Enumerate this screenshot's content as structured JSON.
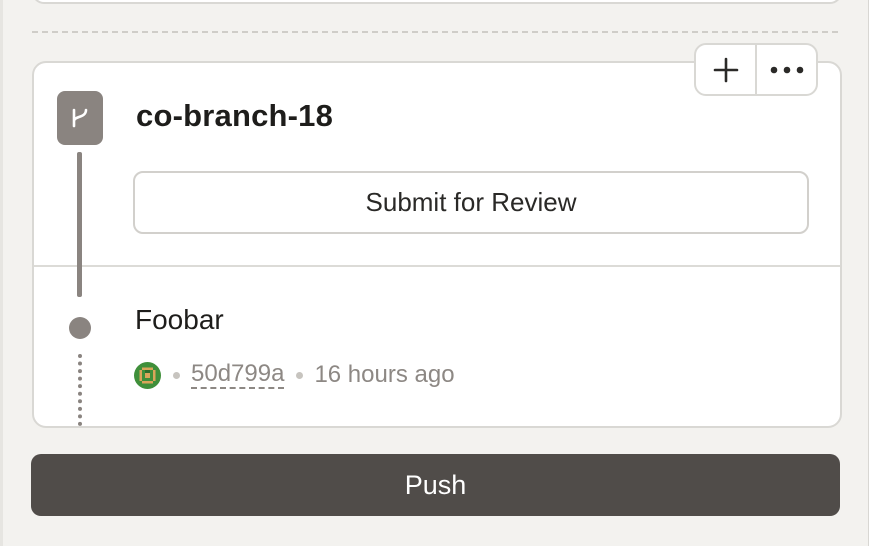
{
  "branch": {
    "name": "co-branch-18",
    "submit_label": "Submit for Review",
    "badge_icon": "branch-icon"
  },
  "toolbar": {
    "add_icon": "plus-icon",
    "more_icon": "ellipsis-icon"
  },
  "commit": {
    "title": "Foobar",
    "hash": "50d799a",
    "time": "16 hours ago",
    "avatar_icon": "user-avatar"
  },
  "actions": {
    "push_label": "Push"
  },
  "colors": {
    "track": "#8a8480",
    "push_bg": "#504c49",
    "background": "#f3f2ef"
  }
}
